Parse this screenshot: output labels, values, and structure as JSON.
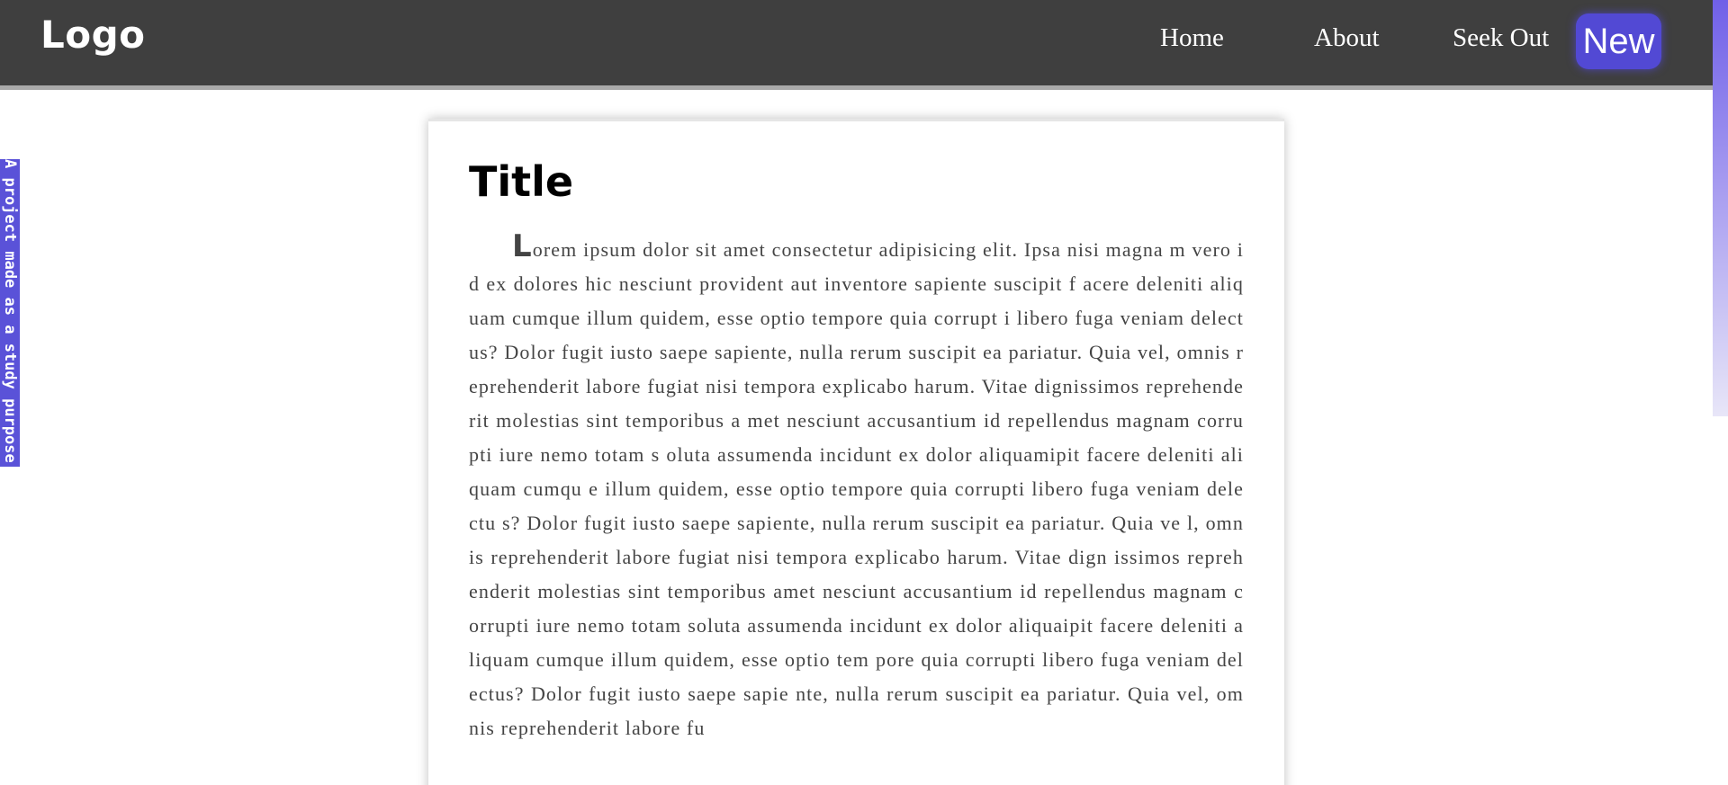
{
  "header": {
    "logo": "Logo",
    "nav": [
      "Home",
      "About",
      "Seek Out"
    ],
    "new_button": "New"
  },
  "ribbon": {
    "text": "A project made as a study purpose"
  },
  "article": {
    "title": "Title",
    "dropcap": "L",
    "body": "orem ipsum dolor sit amet consectetur adipisicing elit. Ipsa nisi magna m vero id ex dolores hic nesciunt provident aut inventore sapiente suscipit f acere deleniti aliquam cumque illum quidem, esse optio tempore quia corrupt i libero fuga veniam delectus? Dolor fugit iusto saepe sapiente, nulla rerum suscipit ea pariatur. Quia vel, omnis reprehenderit labore fugiat nisi tempora explicabo harum. Vitae dignissimos reprehenderit molestias sint temporibus a met nesciunt accusantium id repellendus magnam corrupti iure nemo totam s oluta assumenda incidunt ex dolor aliquamipit facere deleniti aliquam cumqu e illum quidem, esse optio tempore quia corrupti libero fuga veniam delectu s? Dolor fugit iusto saepe sapiente, nulla rerum suscipit ea pariatur. Quia ve l, omnis reprehenderit labore fugiat nisi tempora explicabo harum. Vitae dign issimos reprehenderit molestias sint temporibus amet nesciunt accusantium id repellendus magnam corrupti iure nemo totam soluta assumenda incidunt ex dolor aliquaipit facere deleniti aliquam cumque illum quidem, esse optio tem pore quia corrupti libero fuga veniam delectus? Dolor fugit iusto saepe sapie nte, nulla rerum suscipit ea pariatur. Quia vel, omnis reprehenderit labore fu"
  },
  "colors": {
    "navbar": "#3f3f3f",
    "accent": "#5249d4",
    "ribbon": "#5a52d8"
  }
}
